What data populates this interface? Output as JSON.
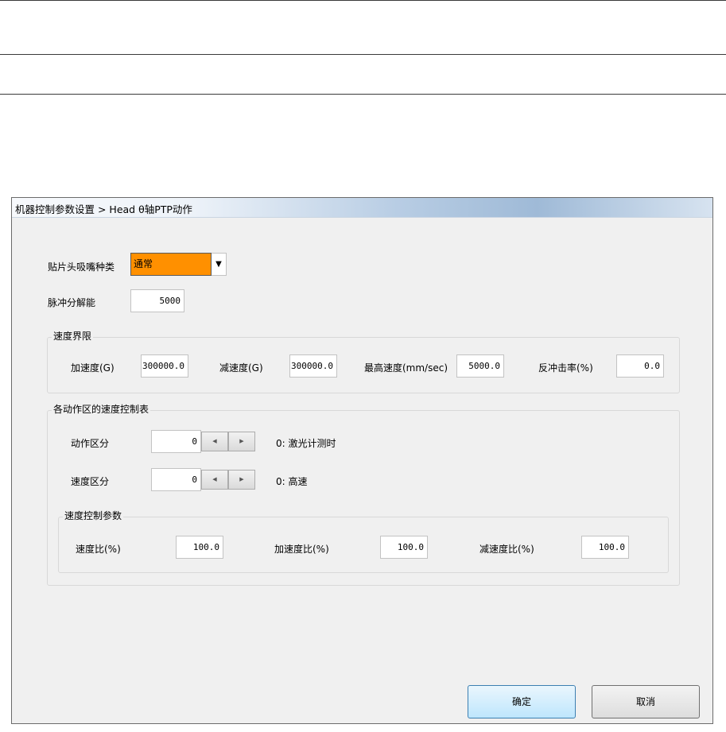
{
  "dialog": {
    "title": "机器控制参数设置 > Head θ轴PTP动作",
    "nozzle_type": {
      "label": "贴片头吸嘴种类",
      "value": "通常"
    },
    "pulse_resolution": {
      "label": "脉冲分解能",
      "value": "5000"
    },
    "speed_limit": {
      "title": "速度界限",
      "accel": {
        "label": "加速度(G)",
        "value": "300000.0"
      },
      "decel": {
        "label": "减速度(G)",
        "value": "300000.0"
      },
      "max_speed": {
        "label": "最高速度(mm/sec)",
        "value": "5000.0"
      },
      "backlash": {
        "label": "反冲击率(%)",
        "value": "0.0"
      }
    },
    "speed_table": {
      "title": "各动作区的速度控制表",
      "action_zone": {
        "label": "动作区分",
        "value": "0",
        "desc": "0: 激光计测时"
      },
      "speed_zone": {
        "label": "速度区分",
        "value": "0",
        "desc": "0: 高速"
      },
      "params": {
        "title": "速度控制参数",
        "speed_ratio": {
          "label": "速度比(%)",
          "value": "100.0"
        },
        "accel_ratio": {
          "label": "加速度比(%)",
          "value": "100.0"
        },
        "decel_ratio": {
          "label": "减速度比(%)",
          "value": "100.0"
        }
      }
    },
    "ok_label": "确定",
    "cancel_label": "取消"
  }
}
